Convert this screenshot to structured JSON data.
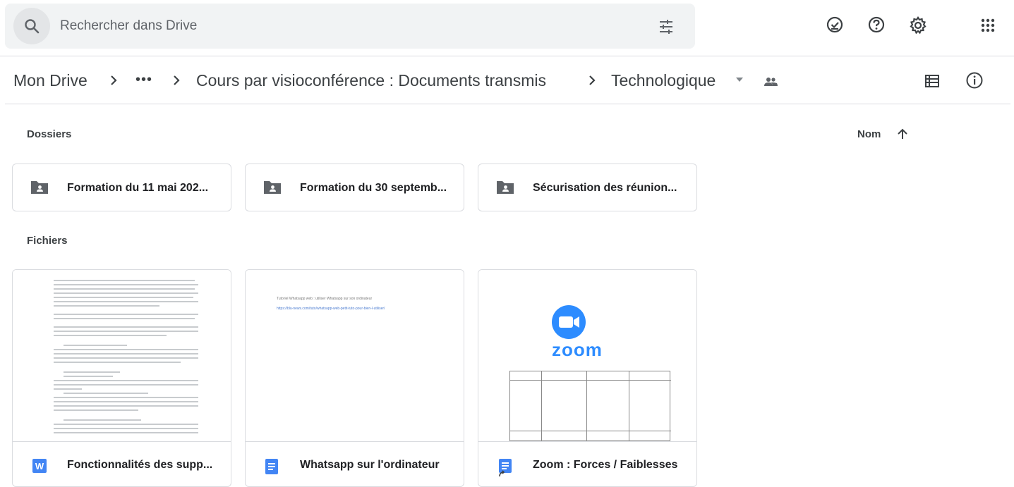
{
  "search": {
    "placeholder": "Rechercher dans Drive"
  },
  "icons": {
    "search": "search-icon",
    "tune": "tune-icon",
    "offline": "offline-ready-icon",
    "help": "help-icon",
    "settings": "settings-icon",
    "apps": "apps-grid-icon",
    "list_view": "list-view-icon",
    "info": "info-icon",
    "shared": "shared-people-icon"
  },
  "breadcrumb": {
    "root": "Mon Drive",
    "ellipsis": "•••",
    "parent": "Cours par visioconférence : Documents transmis",
    "current": "Technologique"
  },
  "sections": {
    "folders": "Dossiers",
    "files": "Fichiers"
  },
  "sort": {
    "label": "Nom"
  },
  "folders": [
    {
      "name": "Formation du 11 mai 202..."
    },
    {
      "name": "Formation du 30 septemb..."
    },
    {
      "name": "Sécurisation des réunion..."
    }
  ],
  "files": [
    {
      "name": "Fonctionnalités des supp...",
      "type": "word"
    },
    {
      "name": "Whatsapp sur l'ordinateur",
      "type": "docs"
    },
    {
      "name": "Zoom : Forces / Faiblesses",
      "type": "docs-shortcut"
    }
  ],
  "thumbnails": {
    "whatsapp_title": "Tutoriel Whatsapp web : utiliser Whatsapp sur son ordinateur",
    "whatsapp_link": "https://blu-news.com/tuto/whatsapp-web-petit-tuto-pour-bien-l-utiliser/",
    "zoom_brand": "zoom"
  },
  "colors": {
    "accent": "#1a73e8",
    "word": "#4285f4",
    "zoom": "#2d8cff"
  }
}
